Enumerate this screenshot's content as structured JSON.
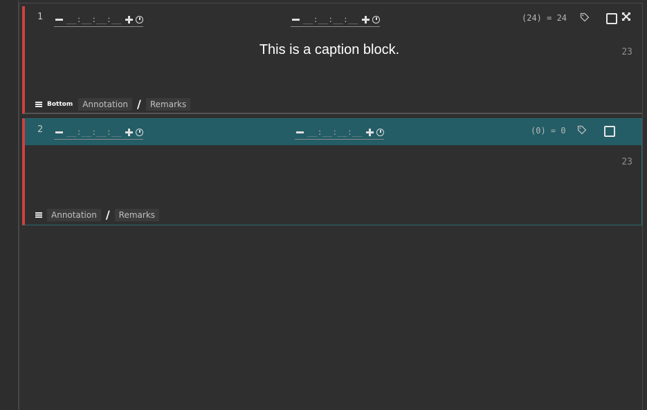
{
  "blocks": [
    {
      "number": "1",
      "start_timecode": "__:__:__:__",
      "end_timecode": "__:__:__:__",
      "duration": "(24) = 24",
      "caption": "This is a caption block.",
      "char_count": "23",
      "layer_label": "Bottom",
      "annotation_label": "Annotation",
      "remarks_label": "Remarks",
      "selected": false
    },
    {
      "number": "2",
      "start_timecode": "__:__:__:__",
      "end_timecode": "__:__:__:__",
      "duration": "(0) = 0",
      "caption": "",
      "char_count": "23",
      "layer_label": "",
      "annotation_label": "Annotation",
      "remarks_label": "Remarks",
      "selected": true
    }
  ],
  "icons": {
    "decrement": "minus-icon",
    "increment": "plus-icon",
    "clock": "clock-icon",
    "tag": "tag-icon",
    "checkbox": "checkbox-icon",
    "expand": "expand-icon",
    "layers": "layers-icon"
  },
  "colors": {
    "background": "#2f2f2f",
    "selected_header": "#245d66",
    "block_marker": "#d04040",
    "caption_text": "#ffffff"
  }
}
